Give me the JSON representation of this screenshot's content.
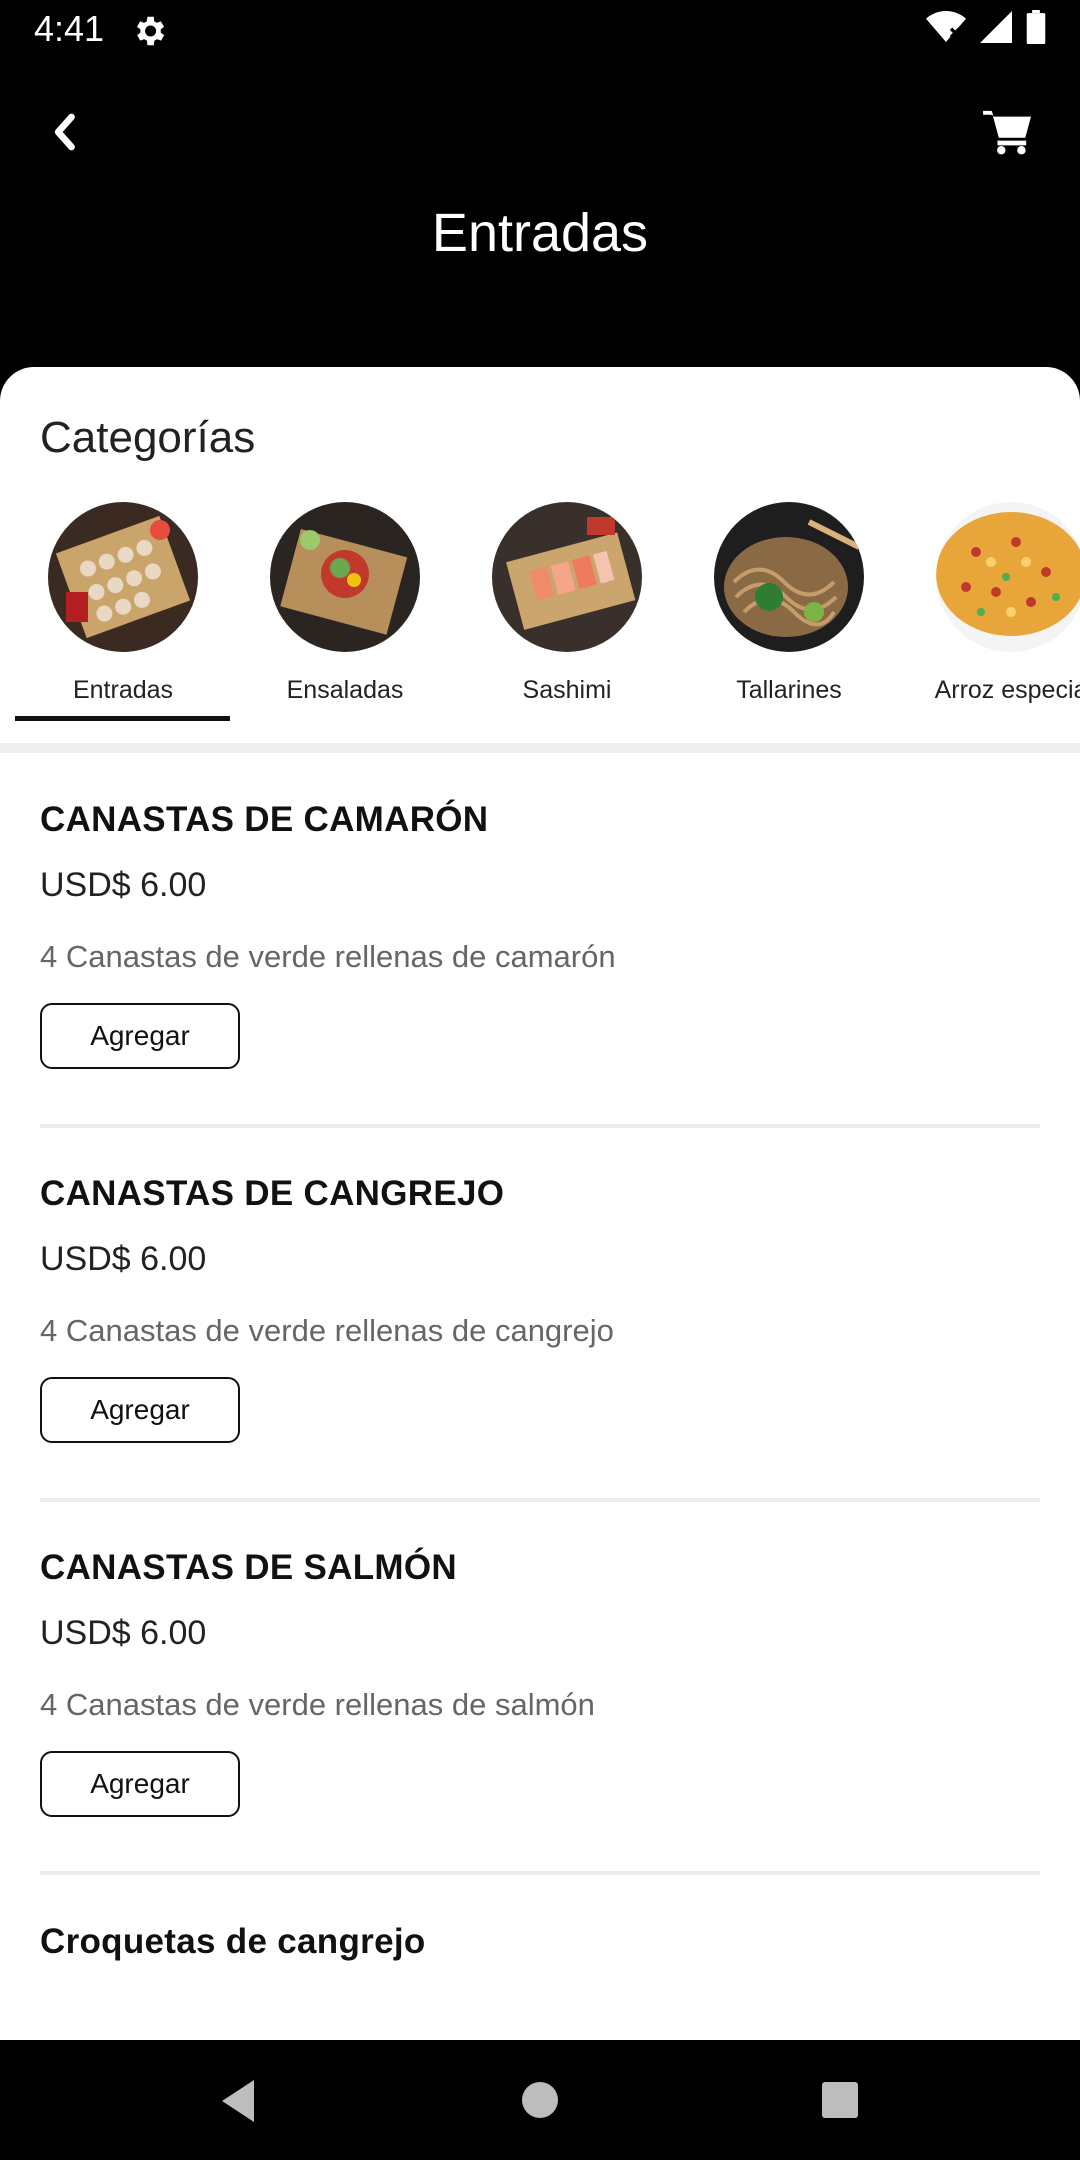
{
  "status_bar": {
    "time": "4:41"
  },
  "header": {
    "title": "Entradas"
  },
  "categories": {
    "heading": "Categorías",
    "items": [
      {
        "label": "Entradas",
        "selected": true
      },
      {
        "label": "Ensaladas"
      },
      {
        "label": "Sashimi"
      },
      {
        "label": "Tallarines"
      },
      {
        "label": "Arroz especia"
      }
    ]
  },
  "products": [
    {
      "name": "CANASTAS DE CAMARÓN",
      "price": "USD$ 6.00",
      "description": "4 Canastas de verde rellenas de camarón",
      "button": "Agregar"
    },
    {
      "name": "CANASTAS DE CANGREJO",
      "price": "USD$ 6.00",
      "description": "4 Canastas de verde rellenas de cangrejo",
      "button": "Agregar"
    },
    {
      "name": "CANASTAS DE SALMÓN",
      "price": "USD$ 6.00",
      "description": "4 Canastas de verde rellenas de salmón",
      "button": "Agregar"
    },
    {
      "name": "Croquetas de cangrejo"
    }
  ],
  "colors": {
    "accent": "#000000",
    "background": "#ffffff",
    "muted_text": "#666666"
  }
}
